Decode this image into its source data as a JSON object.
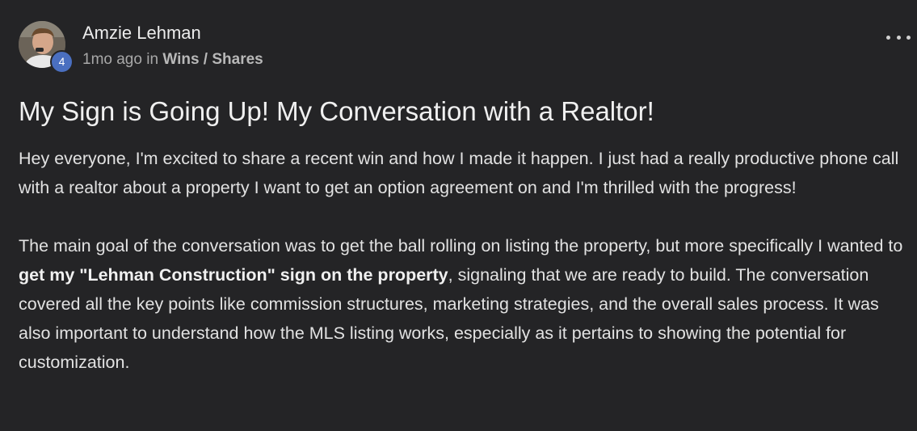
{
  "post": {
    "author": {
      "name": "Amzie Lehman",
      "level": "4"
    },
    "meta": {
      "time": "1mo ago",
      "in_text": "in",
      "category": "Wins / Shares"
    },
    "title": "My Sign is Going Up! My Conversation with a Realtor!",
    "paragraph1": "Hey everyone, I'm excited to share a recent win and how I made it happen. I just had a really productive phone call with a realtor about a property I want to get an option agreement on and I'm thrilled with the progress!",
    "paragraph2": {
      "before": "The main goal of the conversation was to get the ball rolling on listing the property, but more specifically I wanted to ",
      "bold": "get my \"Lehman Construction\" sign on the property",
      "after": ", signaling that we are ready to build. The conversation covered all the key points like commission structures, marketing strategies, and the overall sales process. It was also important to understand how the MLS listing works, especially as it pertains to showing the potential for customization."
    },
    "menu_icon": "more-horizontal-icon"
  },
  "colors": {
    "background": "#242426",
    "badge": "#4a6fc0",
    "text": "#e2e2e2",
    "muted": "#a8a8a8"
  }
}
